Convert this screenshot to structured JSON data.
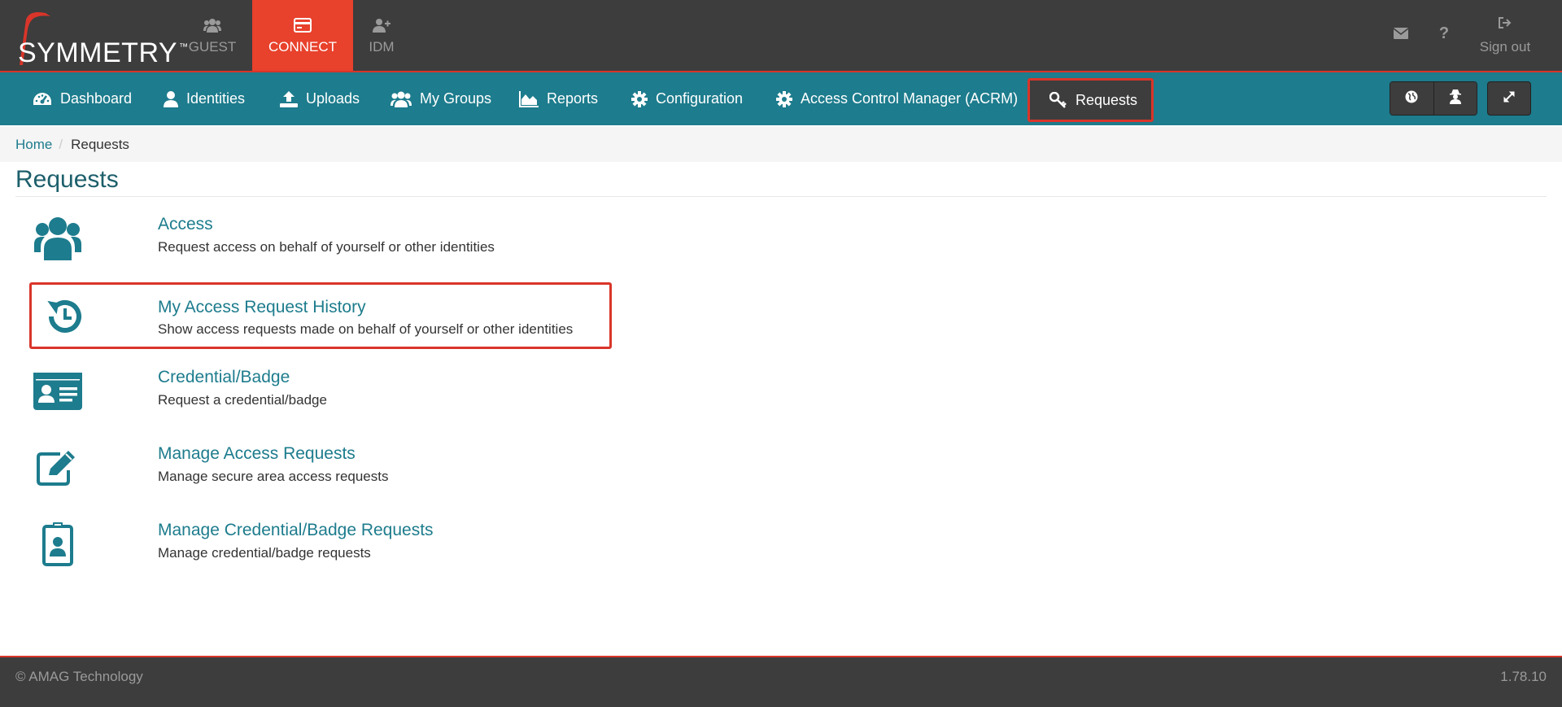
{
  "brand": {
    "name": "SYMMETRY",
    "tm": "™"
  },
  "top_nav": [
    {
      "label": "GUEST",
      "icon": "users-icon"
    },
    {
      "label": "CONNECT",
      "icon": "card-icon"
    },
    {
      "label": "IDM",
      "icon": "add-user-icon"
    }
  ],
  "top_right": {
    "signout_label": "Sign out",
    "help_glyph": "?"
  },
  "nav": {
    "dashboard": "Dashboard",
    "identities": "Identities",
    "uploads": "Uploads",
    "my_groups": "My Groups",
    "reports": "Reports",
    "configuration": "Configuration",
    "acrm": "Access Control Manager (ACRM)",
    "requests": "Requests"
  },
  "breadcrumb": {
    "home": "Home",
    "sep": "/",
    "current": "Requests"
  },
  "page_title": "Requests",
  "items": [
    {
      "title": "Access",
      "description": "Request access on behalf of yourself or other identities",
      "icon": "users-icon"
    },
    {
      "title": "My Access Request History",
      "description": "Show access requests made on behalf of yourself or other identities",
      "icon": "history-icon"
    },
    {
      "title": "Credential/Badge",
      "description": "Request a credential/badge",
      "icon": "id-card-icon"
    },
    {
      "title": "Manage Access Requests",
      "description": "Manage secure area access requests",
      "icon": "edit-icon"
    },
    {
      "title": "Manage Credential/Badge Requests",
      "description": "Manage credential/badge requests",
      "icon": "badge-icon"
    }
  ],
  "footer": {
    "copyright": "© AMAG Technology",
    "version": "1.78.10"
  },
  "colors": {
    "accent": "#1d7c8d",
    "brand_red": "#e8412c",
    "dark": "#3d3d3d"
  }
}
